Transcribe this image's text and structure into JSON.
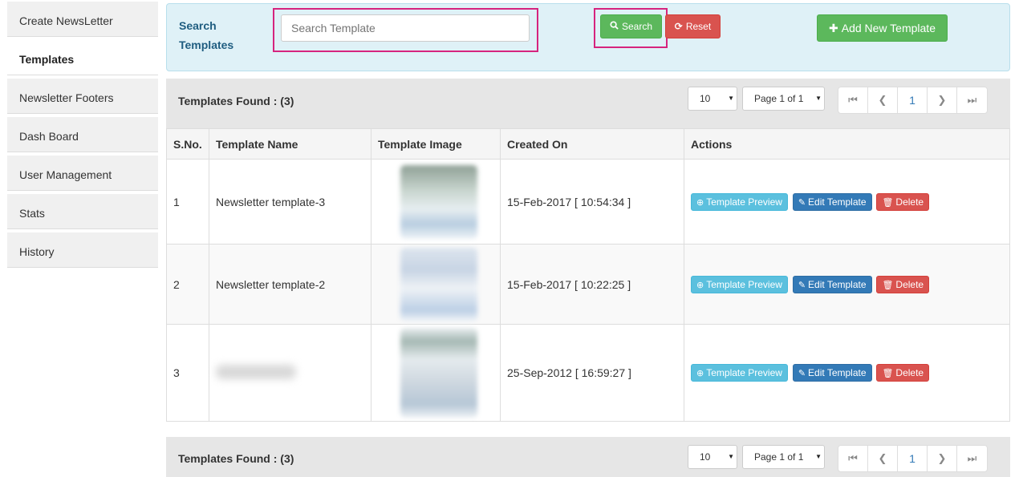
{
  "sidebar": {
    "items": [
      {
        "label": "Create NewsLetter"
      },
      {
        "label": "Templates"
      },
      {
        "label": "Newsletter Footers"
      },
      {
        "label": "Dash Board"
      },
      {
        "label": "User Management"
      },
      {
        "label": "Stats"
      },
      {
        "label": "History"
      }
    ],
    "active": "Templates"
  },
  "search": {
    "label": "Search Templates",
    "placeholder": "Search Template",
    "search_button": "Search",
    "reset_button": "Reset",
    "add_button": "Add New Template"
  },
  "results": {
    "found_label": "Templates Found : (3)",
    "page_size": "10",
    "page_info": "Page 1 of 1",
    "current_page": "1"
  },
  "table": {
    "headers": [
      "S.No.",
      "Template Name",
      "Template Image",
      "Created On",
      "Actions"
    ],
    "rows": [
      {
        "sno": "1",
        "name": "Newsletter template-3",
        "created": "15-Feb-2017 [ 10:54:34 ]"
      },
      {
        "sno": "2",
        "name": "Newsletter template-2",
        "created": "15-Feb-2017 [ 10:22:25 ]"
      },
      {
        "sno": "3",
        "name": "",
        "created": "25-Sep-2012 [ 16:59:27 ]"
      }
    ],
    "actions": {
      "preview": "Template Preview",
      "edit": "Edit Template",
      "delete": "Delete"
    }
  },
  "icons": {
    "search": "search-icon",
    "reset": "refresh-icon",
    "add": "plus-icon",
    "preview": "zoom-in-icon",
    "edit": "edit-icon",
    "delete": "trash-icon"
  },
  "colors": {
    "success": "#5cb85c",
    "danger": "#d9534f",
    "info": "#5bc0de",
    "primary": "#337ab7",
    "highlight": "#d6247e",
    "panel": "#dff1f7"
  }
}
